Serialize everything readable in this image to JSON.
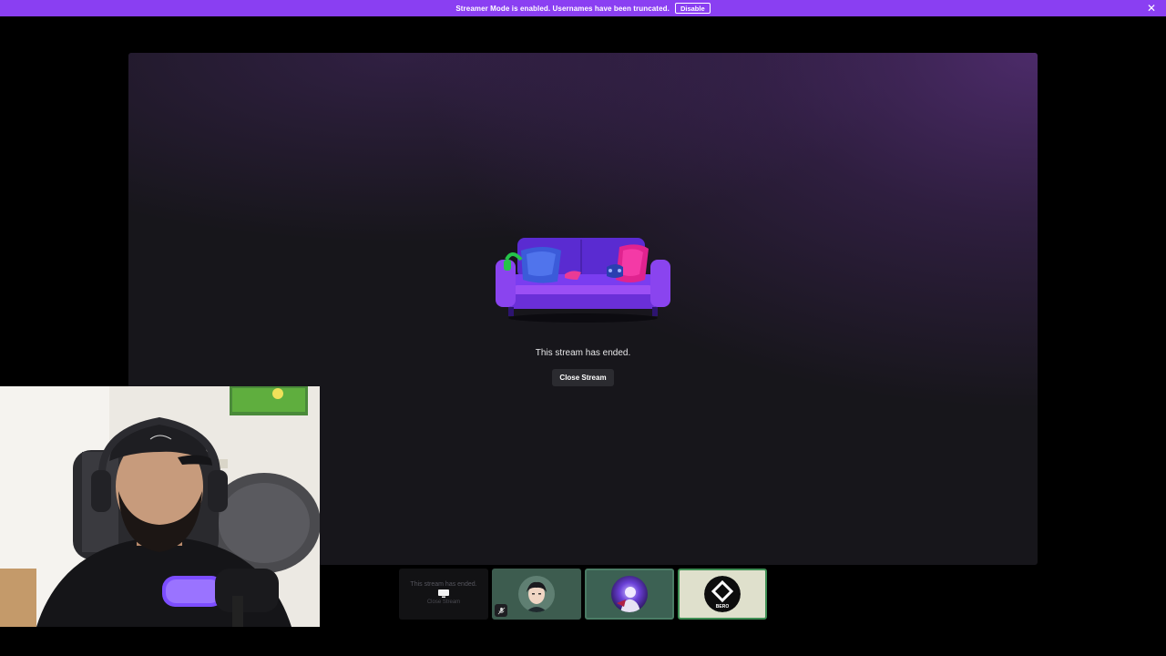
{
  "banner": {
    "message": "Streamer Mode is enabled. Usernames have been truncated.",
    "disable_label": "Disable",
    "close_glyph": "✕"
  },
  "stream": {
    "ended_message": "This stream has ended.",
    "close_label": "Close Stream"
  },
  "tiles": [
    {
      "kind": "stream-ended",
      "message": "This stream has ended.",
      "close_label": "Close Stream",
      "icon": "monitor-icon"
    },
    {
      "kind": "participant",
      "avatar": "anime-character-avatar",
      "muted": true
    },
    {
      "kind": "participant",
      "avatar": "galaxy-character-avatar",
      "muted": false
    },
    {
      "kind": "participant",
      "avatar": "bero-logo-avatar",
      "logo_text": "BERO",
      "muted": false
    }
  ],
  "colors": {
    "banner": "#8a3ff2",
    "stage": "#17161b",
    "stage_glow": "#7a3caa",
    "tile_green": "#3d5c4f",
    "tile_light": "#dfe0cc"
  }
}
